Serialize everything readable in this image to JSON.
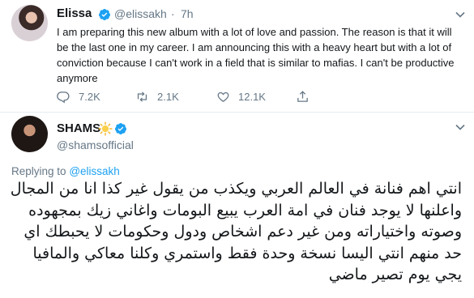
{
  "tweet1": {
    "display_name": "Elissa",
    "handle": "@elissakh",
    "separator": "·",
    "time": "7h",
    "text": "I am preparing this new album with a lot of love and passion. The reason is that it will be the last one in my career. I am announcing this with a heavy heart but with a lot of conviction because I can't work in a field that is similar to mafias. I can't be productive anymore",
    "replies": "7.2K",
    "retweets": "2.1K",
    "likes": "12.1K"
  },
  "tweet2": {
    "display_name": "SHAMS",
    "emoji": "sun-emoji",
    "handle": "@shamsofficial",
    "replying_label": "Replying to",
    "replying_handle": "@elissakh",
    "text": "انتي اهم فنانة في العالم العربي ويكذب من يقول غير كذا انا من المجال واعلنها لا يوجد فنان في امة العرب يبيع البومات واغاني زيك بمجهوده وصوته واختياراته ومن غير دعم اشخاص ودول وحكومات لا يحبطك اي حد منهم انتي اليسا نسخة وحدة فقط واستمري وكلنا معاكي والمافيا يجي يوم تصير ماضي"
  },
  "colors": {
    "verified_blue": "#1da1f2",
    "secondary_text": "#657786",
    "primary_text": "#14171a",
    "divider": "#e6ecf0"
  }
}
